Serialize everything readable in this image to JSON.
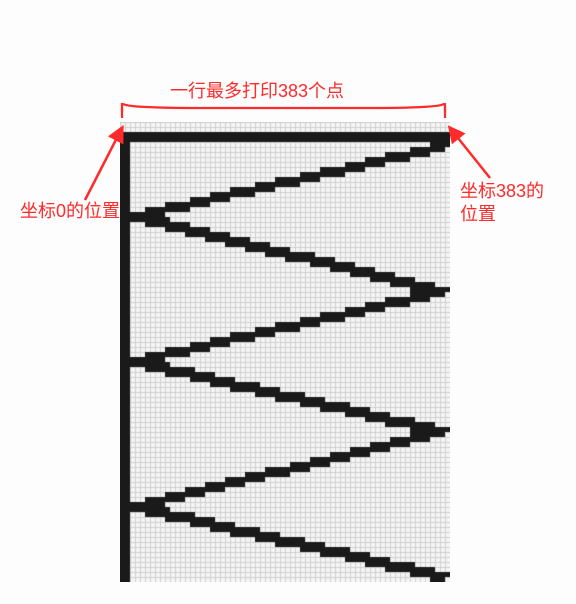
{
  "labels": {
    "top": "一行最多打印383个点",
    "left": "坐标0的位置",
    "right": "坐标383的\n位置"
  },
  "diagram": {
    "max_dots_per_line": 383,
    "left_coordinate": 0,
    "right_coordinate": 383,
    "wave_cycles": 3,
    "colors": {
      "annotation": "#ff2a2a",
      "curve": "#1a1a1a",
      "grid_line": "#d0d0d0",
      "grid_bg": "#f4f5f4"
    }
  }
}
